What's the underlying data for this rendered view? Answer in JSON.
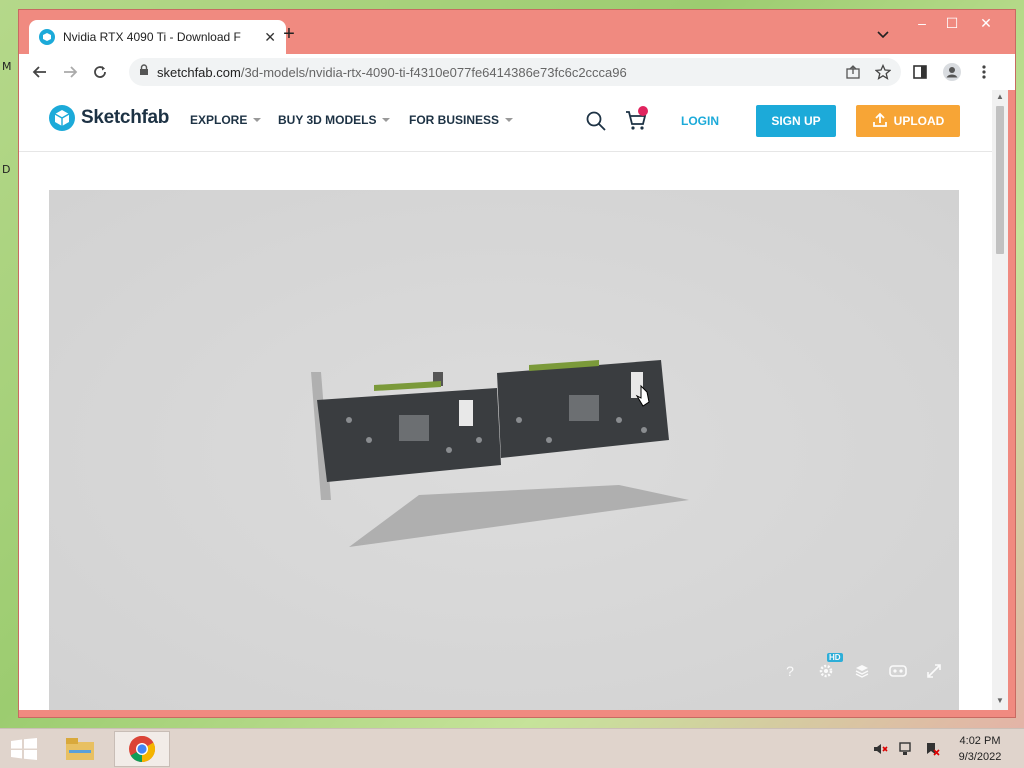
{
  "desktop": {
    "side_letters": [
      "M",
      "D"
    ]
  },
  "browser": {
    "tab": {
      "title": "Nvidia RTX 4090 Ti - Download F"
    },
    "window_controls": {
      "minimize": "–",
      "maximize": "☐",
      "close": "✕"
    },
    "address": {
      "domain": "sketchfab.com",
      "path": "/3d-models/nvidia-rtx-4090-ti-f4310e077fe6414386e73fc6c2ccca96"
    }
  },
  "site": {
    "logo_text": "Sketchfab",
    "nav": [
      {
        "label": "EXPLORE"
      },
      {
        "label": "BUY 3D MODELS"
      },
      {
        "label": "FOR BUSINESS"
      }
    ],
    "login_label": "LOGIN",
    "signup_label": "SIGN UP",
    "upload_label": "UPLOAD",
    "brand_color": "#1caad9",
    "upload_color": "#f7a536"
  },
  "viewer": {
    "help_icon": "?",
    "hd_badge": "HD"
  },
  "taskbar": {
    "time": "4:02 PM",
    "date": "9/3/2022"
  }
}
